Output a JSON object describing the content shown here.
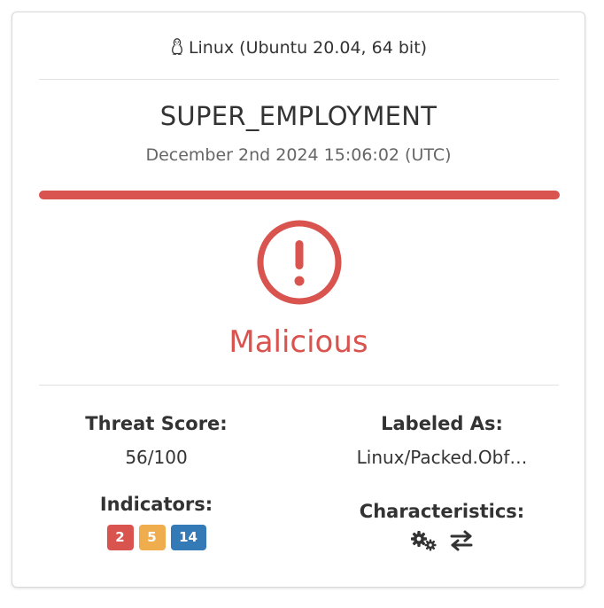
{
  "os": {
    "icon": "linux-icon",
    "label": "Linux (Ubuntu 20.04, 64 bit)"
  },
  "sample": {
    "name": "SUPER_EMPLOYMENT",
    "date": "December 2nd 2024 15:06:02 (UTC)"
  },
  "verdict": {
    "label": "Malicious",
    "icon": "exclamation-circle-icon",
    "color": "#d9534f"
  },
  "threat_score": {
    "label": "Threat Score:",
    "value": "56/100"
  },
  "labeled_as": {
    "label": "Labeled As:",
    "value": "Linux/Packed.Obf…"
  },
  "indicators": {
    "label": "Indicators:",
    "malicious": "2",
    "suspicious": "5",
    "informative": "14",
    "colors": {
      "malicious": "#d9534f",
      "suspicious": "#f0ad4e",
      "informative": "#337ab7"
    }
  },
  "characteristics": {
    "label": "Characteristics:",
    "icons": [
      "gears-icon",
      "exchange-arrows-icon"
    ]
  }
}
